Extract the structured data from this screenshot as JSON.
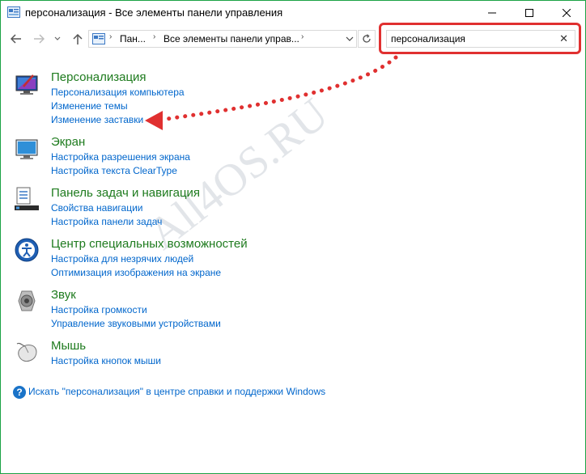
{
  "window": {
    "title": "персонализация - Все элементы панели управления",
    "border_color": "#1ba345"
  },
  "titlebar_buttons": {
    "minimize_icon": "minimize-icon",
    "maximize_icon": "maximize-icon",
    "close_icon": "close-icon"
  },
  "address": {
    "segments": [
      "Пан...",
      "Все элементы панели управ..."
    ]
  },
  "search": {
    "value": "персонализация",
    "clear_symbol": "✕"
  },
  "categories": [
    {
      "title": "Персонализация",
      "icon": "personalization-icon",
      "links": [
        "Персонализация компьютера",
        "Изменение темы",
        "Изменение заставки"
      ]
    },
    {
      "title": "Экран",
      "icon": "display-icon",
      "links": [
        "Настройка разрешения экрана",
        "Настройка текста ClearType"
      ]
    },
    {
      "title": "Панель задач и навигация",
      "icon": "taskbar-icon",
      "links": [
        "Свойства навигации",
        "Настройка панели задач"
      ]
    },
    {
      "title": "Центр специальных возможностей",
      "icon": "accessibility-icon",
      "links": [
        "Настройка для незрячих людей",
        "Оптимизация изображения на экране"
      ]
    },
    {
      "title": "Звук",
      "icon": "sound-icon",
      "links": [
        "Настройка громкости",
        "Управление звуковыми устройствами"
      ]
    },
    {
      "title": "Мышь",
      "icon": "mouse-icon",
      "links": [
        "Настройка кнопок мыши"
      ]
    }
  ],
  "help": {
    "text": "Искать \"персонализация\" в центре справки и поддержки Windows",
    "icon_symbol": "?"
  },
  "watermark": "All4OS.RU",
  "colors": {
    "category_title": "#1e7b1e",
    "link": "#0066cc",
    "annotation_red": "#e03030"
  }
}
